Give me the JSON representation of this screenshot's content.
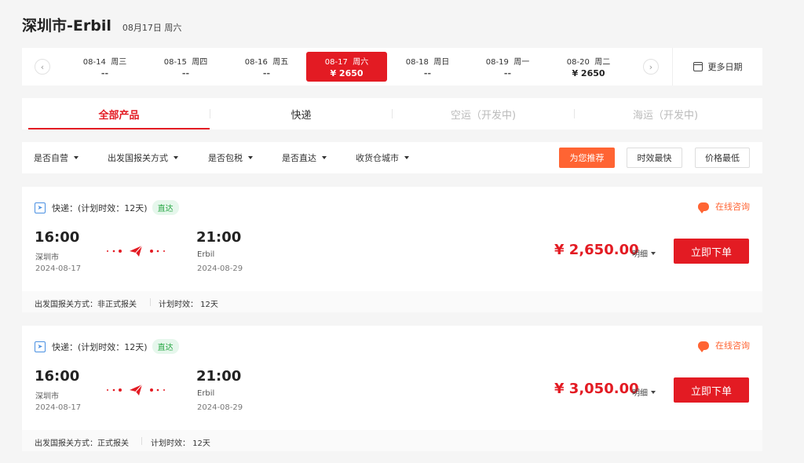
{
  "header": {
    "route": "深圳市-Erbil",
    "date": "08月17日 周六"
  },
  "date_bar": {
    "prev_icon": "chevron-left-icon",
    "next_icon": "chevron-right-icon",
    "days": [
      {
        "date": "08-14",
        "weekday": "周三",
        "price": "--"
      },
      {
        "date": "08-15",
        "weekday": "周四",
        "price": "--"
      },
      {
        "date": "08-16",
        "weekday": "周五",
        "price": "--"
      },
      {
        "date": "08-17",
        "weekday": "周六",
        "price": "¥ 2650"
      },
      {
        "date": "08-18",
        "weekday": "周日",
        "price": "--"
      },
      {
        "date": "08-19",
        "weekday": "周一",
        "price": "--"
      },
      {
        "date": "08-20",
        "weekday": "周二",
        "price": "¥ 2650"
      }
    ],
    "selected_index": 3,
    "more_label": "更多日期"
  },
  "tabs": [
    {
      "label": "全部产品",
      "state": "active"
    },
    {
      "label": "快递",
      "state": "normal"
    },
    {
      "label": "空运（开发中)",
      "state": "disabled"
    },
    {
      "label": "海运（开发中)",
      "state": "disabled"
    }
  ],
  "filters": {
    "items": [
      "是否自营",
      "出发国报关方式",
      "是否包税",
      "是否直达",
      "收货仓城市"
    ],
    "sort": [
      {
        "label": "为您推荐",
        "active": true
      },
      {
        "label": "时效最快",
        "active": false
      },
      {
        "label": "价格最低",
        "active": false
      }
    ]
  },
  "cards": [
    {
      "service": "快递：(计划时效：12天)",
      "badge": "直达",
      "consult": "在线咨询",
      "depart_time": "16:00",
      "depart_city": "深圳市",
      "depart_date": "2024-08-17",
      "arrive_time": "21:00",
      "arrive_city": "Erbil",
      "arrive_date": "2024-08-29",
      "price": "¥ 2,650.00",
      "detail": "明细",
      "order": "立即下单",
      "customs": "出发国报关方式：非正式报关",
      "timing": "计划时效：  12天"
    },
    {
      "service": "快递：(计划时效：12天)",
      "badge": "直达",
      "consult": "在线咨询",
      "depart_time": "16:00",
      "depart_city": "深圳市",
      "depart_date": "2024-08-17",
      "arrive_time": "21:00",
      "arrive_city": "Erbil",
      "arrive_date": "2024-08-29",
      "price": "¥ 3,050.00",
      "detail": "明细",
      "order": "立即下单",
      "customs": "出发国报关方式：正式报关",
      "timing": "计划时效：  12天"
    }
  ],
  "colors": {
    "accent": "#e31b23",
    "orange": "#ff6433",
    "green": "#28a745"
  }
}
